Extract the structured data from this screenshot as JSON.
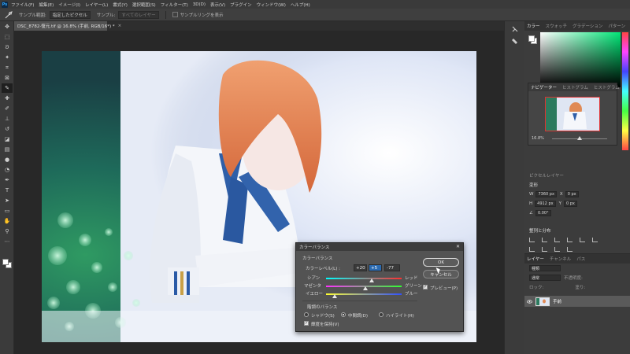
{
  "app": {
    "logo": "Ps"
  },
  "menubar": {
    "items": [
      "ファイル(F)",
      "編集(E)",
      "イメージ(I)",
      "レイヤー(L)",
      "書式(Y)",
      "選択範囲(S)",
      "フィルター(T)",
      "3D(D)",
      "表示(V)",
      "プラグイン",
      "ウィンドウ(W)",
      "ヘルプ(H)"
    ]
  },
  "options": {
    "sample_size_label": "サンプル範囲:",
    "sample_size_value": "指定したピクセル",
    "sample_label": "サンプル:",
    "sample_value": "すべてのレイヤー",
    "show_ring_label": "サンプルリングを表示"
  },
  "document": {
    "tab_title": "DSC_8782-復元.tif @ 16.8% (手前, RGB/16*) *",
    "close_glyph": "×"
  },
  "panels": {
    "color_tabs": [
      "カラー",
      "スウォッチ",
      "グラデーション",
      "パターン"
    ],
    "nav_tabs": [
      "ナビゲーター",
      "ヒストグラム",
      "ヒストグラム"
    ],
    "nav_zoom": "16.8%",
    "props_title": "変形",
    "w_label": "W",
    "w_value": "7360 px",
    "h_label": "H",
    "h_value": "4912 px",
    "x_label": "X",
    "x_value": "0 px",
    "y_label": "Y",
    "y_value": "0 px",
    "angle_value": "0.00°",
    "align_title": "整列と分布",
    "layers_tabs": [
      "レイヤー",
      "チャンネル",
      "パス"
    ],
    "layer_kind": "種類",
    "layer_blend": "通常",
    "layer_opacity": "不透明度:",
    "layer_lock": "ロック:",
    "layer_fill": "塗り:",
    "layer_name": "手前",
    "pixel_layer_label": "ピクセルレイヤー"
  },
  "dialog": {
    "title": "カラーバランス",
    "close_glyph": "✕",
    "balance_group": "カラーバランス",
    "levels_label": "カラーレベル(L) :",
    "level1": "+20",
    "level2": "+5",
    "level3": "-77",
    "sliders": [
      {
        "left": "シアン",
        "right": "レッド",
        "value": 20
      },
      {
        "left": "マゼンタ",
        "right": "グリーン",
        "value": 5
      },
      {
        "left": "イエロー",
        "right": "ブルー",
        "value": -77
      }
    ],
    "tone_group": "階調のバランス",
    "tone_shadows": "シャドウ(S)",
    "tone_midtones": "中間調(D)",
    "tone_highlights": "ハイライト(H)",
    "preserve_luminosity": "輝度を保持(V)",
    "ok": "OK",
    "cancel": "キャンセル",
    "preview": "プレビュー(P)",
    "check_glyph": "✓"
  },
  "colors": {
    "track1": [
      "#00ffff",
      "#ff3030"
    ],
    "track2": [
      "#ff30ff",
      "#30ff30"
    ],
    "track3": [
      "#ffff30",
      "#3050ff"
    ]
  }
}
